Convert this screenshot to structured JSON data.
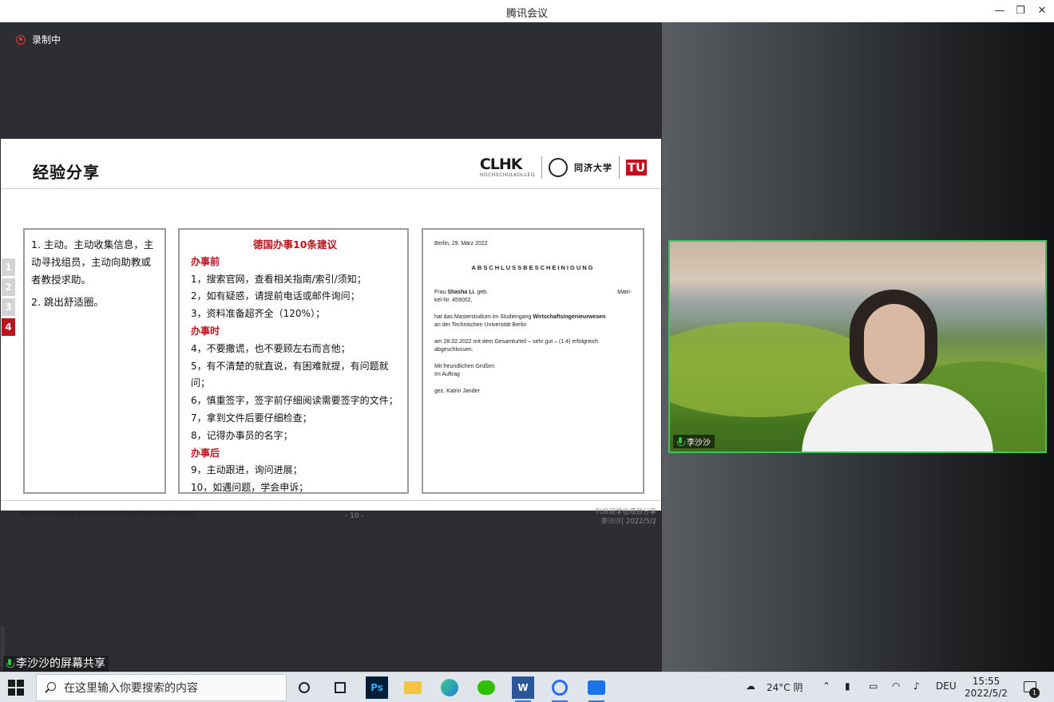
{
  "window": {
    "title": "腾讯会议",
    "minimize_glyph": "—",
    "restore_glyph": "❐",
    "close_glyph": "✕"
  },
  "recording": {
    "label": "录制中"
  },
  "slide": {
    "title": "经验分享",
    "logos": {
      "clhk": "CLHK",
      "clhk_sub": "HOCHSCHULKOLLEG",
      "tongji": "同济大学",
      "tu": "TU"
    },
    "section_numbers": [
      "1",
      "2",
      "3",
      "4"
    ],
    "active_section": "4",
    "box1": {
      "item1": "1. 主动。主动收集信息，主动寻找组员，主动向助教或者教授求助。",
      "item2": "2. 跳出舒适圈。"
    },
    "box2": {
      "heading": "德国办事10条建议",
      "before_label": "办事前",
      "before_items": [
        "1，搜索官网，查看相关指南/索引/须知；",
        "2，如有疑惑，请提前电话或邮件询问；",
        "3，资料准备超齐全（120%）；"
      ],
      "during_label": "办事时",
      "during_items": [
        "4，不要撒谎，也不要顾左右而言他；",
        "5，有不清楚的就直说，有困难就提，有问题就问；",
        "6，慎重签字，签字前仔细阅读需要签字的文件；",
        "7，拿到文件后要仔细检查；",
        "8，记得办事员的名字；"
      ],
      "after_label": "办事后",
      "after_items": [
        "9，主动跟进，询问进展；",
        "10，如遇问题，学会申诉；"
      ]
    },
    "box3": {
      "date": "Berlin, 29. März 2022",
      "cert_title": "ABSCHLUSSBESCHEINIGUNG",
      "line1_pre": "Frau ",
      "line1_name": "Shasha Li",
      "line1_post": ", geb.",
      "line1_right": "Matri-",
      "line2": "kel-Nr. 459002,",
      "line3_pre": "hat das Masterstudium im Studiengang ",
      "line3_bold": "Wirtschaftsingenieurwesen",
      "line4": "an der Technischen Universität Berlin",
      "line5": "am 28.02.2022 mit dem Gesamturteil – sehr gut – (1.4) erfolgreich",
      "line6": "abgeschlossen.",
      "greet1": "Mit freundlichen Grüßen",
      "greet2": "Im Auftrag",
      "signed": "gez. Katrin Jander"
    },
    "footer": {
      "url": "https://mp.weixin.qq.com/s/KJc1h1yKGnvsVgBHajlpvQ",
      "page": "- 10 -",
      "right_line1": "TUB双学位项目分享",
      "right_line2": "李沙沙| 2022/5/2"
    }
  },
  "screen_share_label": "李沙沙的屏幕共享",
  "video": {
    "participant_name": "李沙沙"
  },
  "taskbar": {
    "search_placeholder": "在这里输入你要搜索的内容",
    "apps": [
      "cortana-circle",
      "task-view",
      "photoshop",
      "file-explorer",
      "edge",
      "wechat",
      "word",
      "tencent-meeting-1",
      "tencent-meeting-2"
    ],
    "ps_label": "Ps",
    "word_label": "W",
    "weather": "24°C 阴",
    "language": "DEU",
    "time": "15:55",
    "date": "2022/5/2",
    "notification_count": "1"
  },
  "colors": {
    "accent_red": "#b9151d",
    "active_speaker_border": "#3ec45a",
    "recording_red": "#e23a3a"
  }
}
